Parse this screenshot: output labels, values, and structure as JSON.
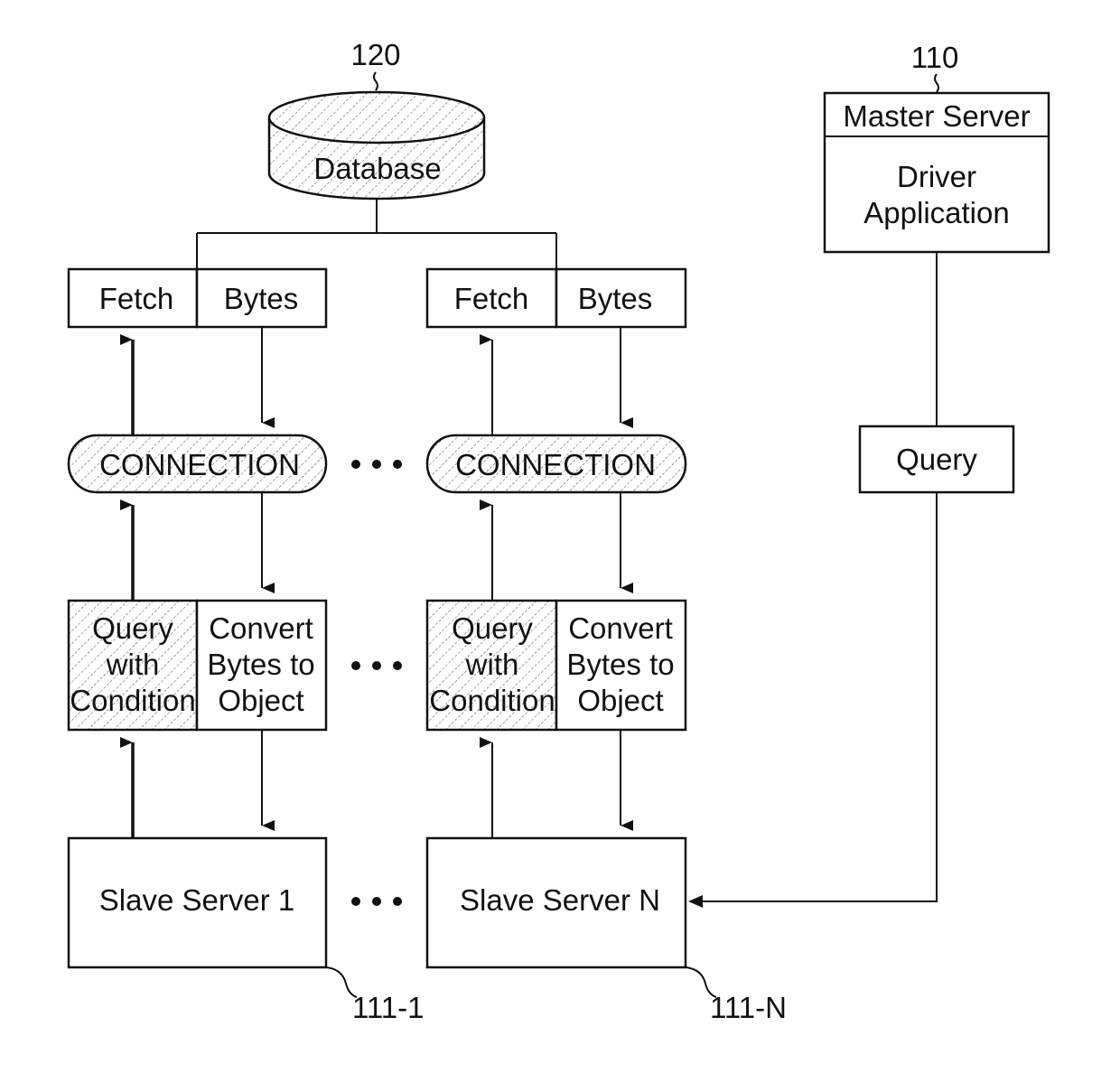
{
  "diagram": {
    "database": {
      "ref": "120",
      "label": "Database"
    },
    "master": {
      "ref": "110",
      "title": "Master Server",
      "app_line1": "Driver",
      "app_line2": "Application"
    },
    "query_box": "Query",
    "columns": [
      {
        "fetch": "Fetch",
        "bytes": "Bytes",
        "connection": "CONNECTION",
        "query_line1": "Query",
        "query_line2": "with",
        "query_line3": "Condition",
        "convert_line1": "Convert",
        "convert_line2": "Bytes to",
        "convert_line3": "Object",
        "slave": "Slave Server 1",
        "ref": "111-1"
      },
      {
        "fetch": "Fetch",
        "bytes": "Bytes",
        "connection": "CONNECTION",
        "query_line1": "Query",
        "query_line2": "with",
        "query_line3": "Condition",
        "convert_line1": "Convert",
        "convert_line2": "Bytes to",
        "convert_line3": "Object",
        "slave": "Slave Server N",
        "ref": "111-N"
      }
    ],
    "ellipsis": "•••"
  }
}
